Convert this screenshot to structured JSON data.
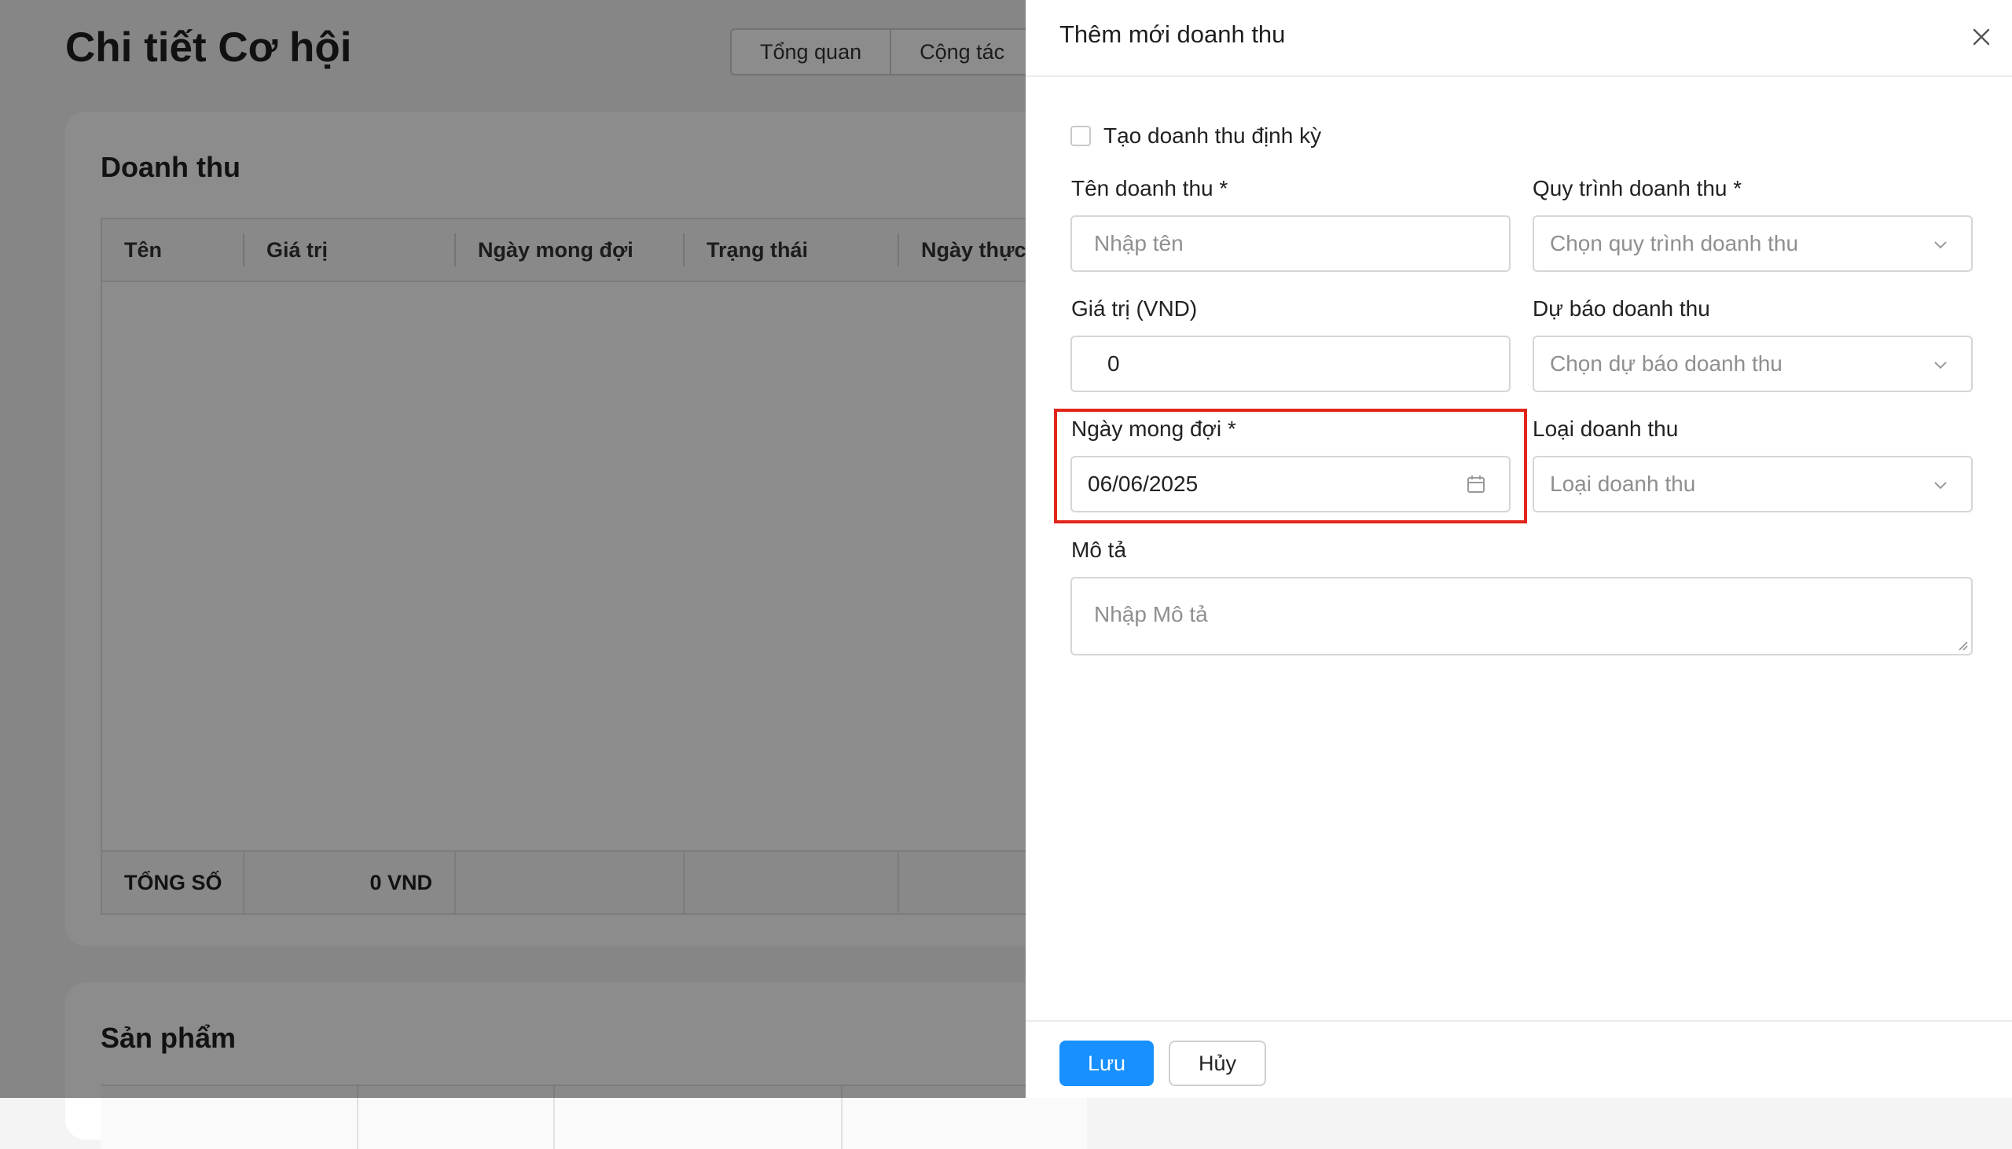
{
  "page": {
    "title": "Chi tiết Cơ hội",
    "tabs": [
      "Tổng quan",
      "Cộng tác"
    ]
  },
  "revenue_card": {
    "title": "Doanh thu",
    "columns": [
      "Tên",
      "Giá trị",
      "Ngày mong đợi",
      "Trạng thái",
      "Ngày thực"
    ],
    "footer": {
      "label": "TỔNG SỐ",
      "total": "0 VND"
    }
  },
  "products_card": {
    "title": "Sản phẩm"
  },
  "drawer": {
    "title": "Thêm mới doanh thu",
    "recurring_checkbox": {
      "label": "Tạo doanh thu định kỳ",
      "checked": false
    },
    "name_field": {
      "label": "Tên doanh thu *",
      "placeholder": "Nhập tên"
    },
    "process_field": {
      "label": "Quy trình doanh thu *",
      "placeholder": "Chọn quy trình doanh thu"
    },
    "value_field": {
      "label": "Giá trị (VND)",
      "value": "0"
    },
    "forecast_field": {
      "label": "Dự báo doanh thu",
      "placeholder": "Chọn dự báo doanh thu"
    },
    "expected_date_field": {
      "label": "Ngày mong đợi *",
      "value": "06/06/2025"
    },
    "type_field": {
      "label": "Loại doanh thu",
      "placeholder": "Loại doanh thu"
    },
    "description_field": {
      "label": "Mô tả",
      "placeholder": "Nhập Mô tả"
    },
    "footer": {
      "save_label": "Lưu",
      "cancel_label": "Hủy"
    }
  },
  "colors": {
    "primary": "#1890ff",
    "highlight": "#e1251b"
  }
}
